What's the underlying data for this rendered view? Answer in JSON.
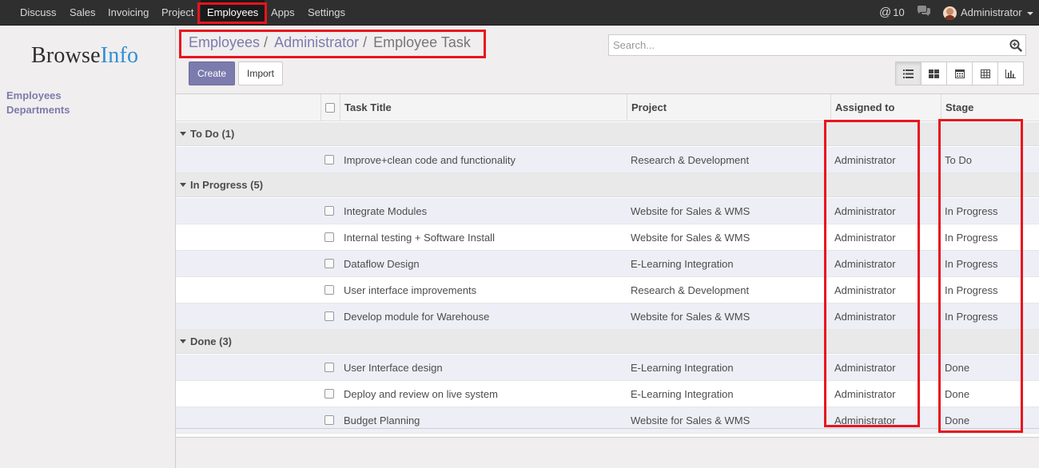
{
  "topbar": {
    "menu": [
      "Discuss",
      "Sales",
      "Invoicing",
      "Project",
      "Employees",
      "Apps",
      "Settings"
    ],
    "active_menu": "Employees",
    "mentions_count": "10",
    "user_name": "Administrator"
  },
  "sidebar": {
    "logo_main": "Browse",
    "logo_accent": "Info",
    "links": [
      "Employees",
      "Departments"
    ]
  },
  "breadcrumb": {
    "items": [
      "Employees",
      "Administrator"
    ],
    "current": "Employee Task",
    "separator": "/"
  },
  "search": {
    "placeholder": "Search..."
  },
  "buttons": {
    "create": "Create",
    "import": "Import"
  },
  "views": [
    "list-view-icon",
    "kanban-view-icon",
    "calendar-view-icon",
    "pivot-view-icon",
    "graph-view-icon"
  ],
  "table": {
    "headers": {
      "title": "Task Title",
      "project": "Project",
      "assigned": "Assigned to",
      "stage": "Stage"
    },
    "groups": [
      {
        "label": "To Do (1)",
        "rows": [
          {
            "title": "Improve+clean code and functionality",
            "project": "Research & Development",
            "assigned": "Administrator",
            "stage": "To Do"
          }
        ]
      },
      {
        "label": "In Progress (5)",
        "rows": [
          {
            "title": "Integrate Modules",
            "project": "Website for Sales & WMS",
            "assigned": "Administrator",
            "stage": "In Progress"
          },
          {
            "title": "Internal testing + Software Install",
            "project": "Website for Sales & WMS",
            "assigned": "Administrator",
            "stage": "In Progress"
          },
          {
            "title": "Dataflow Design",
            "project": "E-Learning Integration",
            "assigned": "Administrator",
            "stage": "In Progress"
          },
          {
            "title": "User interface improvements",
            "project": "Research & Development",
            "assigned": "Administrator",
            "stage": "In Progress"
          },
          {
            "title": "Develop module for Warehouse",
            "project": "Website for Sales & WMS",
            "assigned": "Administrator",
            "stage": "In Progress"
          }
        ]
      },
      {
        "label": "Done (3)",
        "rows": [
          {
            "title": "User Interface design",
            "project": "E-Learning Integration",
            "assigned": "Administrator",
            "stage": "Done"
          },
          {
            "title": "Deploy and review on live system",
            "project": "E-Learning Integration",
            "assigned": "Administrator",
            "stage": "Done"
          },
          {
            "title": "Budget Planning",
            "project": "Website for Sales & WMS",
            "assigned": "Administrator",
            "stage": "Done"
          }
        ]
      }
    ]
  },
  "colors": {
    "brand": "#7c7bad",
    "highlight": "#e8141e",
    "navbar": "#2f2f2f",
    "logo_accent": "#2f8fd6"
  }
}
